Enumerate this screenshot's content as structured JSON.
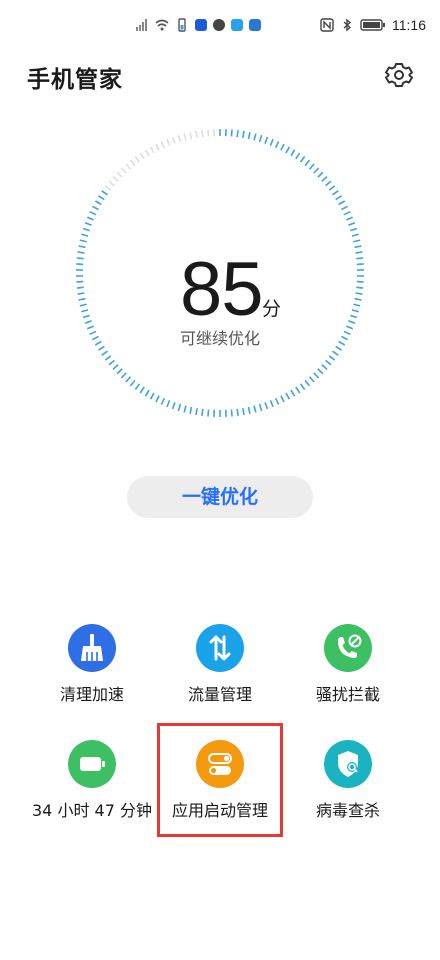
{
  "status_bar": {
    "time": "11:16",
    "left_icons": [
      "no-signal-icon",
      "wifi-icon",
      "battery-saver-icon",
      "bluetooth-app-icon",
      "compass-app-icon",
      "image-app-icon",
      "app-notification-icon"
    ],
    "right_icons": [
      "nfc-icon",
      "bluetooth-icon",
      "battery-icon"
    ]
  },
  "header": {
    "title": "手机管家",
    "settings_icon": "gear-icon"
  },
  "score": {
    "value": "85",
    "unit": "分",
    "subtitle": "可继续优化",
    "level_percent": 85
  },
  "optimize_button": {
    "label": "一键优化"
  },
  "tools": [
    {
      "label": "清理加速",
      "icon": "broom-icon",
      "color": "#2f6fe6"
    },
    {
      "label": "流量管理",
      "icon": "data-arrows-icon",
      "color": "#1aa3e8"
    },
    {
      "label": "骚扰拦截",
      "icon": "blocked-call-icon",
      "color": "#3cc063"
    },
    {
      "label": "34 小时 47 分钟",
      "icon": "battery-icon",
      "color": "#3cc063"
    },
    {
      "label": "应用启动管理",
      "icon": "toggle-switches-icon",
      "color": "#f5990f"
    },
    {
      "label": "病毒查杀",
      "icon": "shield-search-icon",
      "color": "#1ab3c2"
    }
  ],
  "colors": {
    "accent": "#256fff",
    "dial_active": "#3ea2e0",
    "dial_inactive": "#dedede",
    "highlight": "#e53935"
  }
}
